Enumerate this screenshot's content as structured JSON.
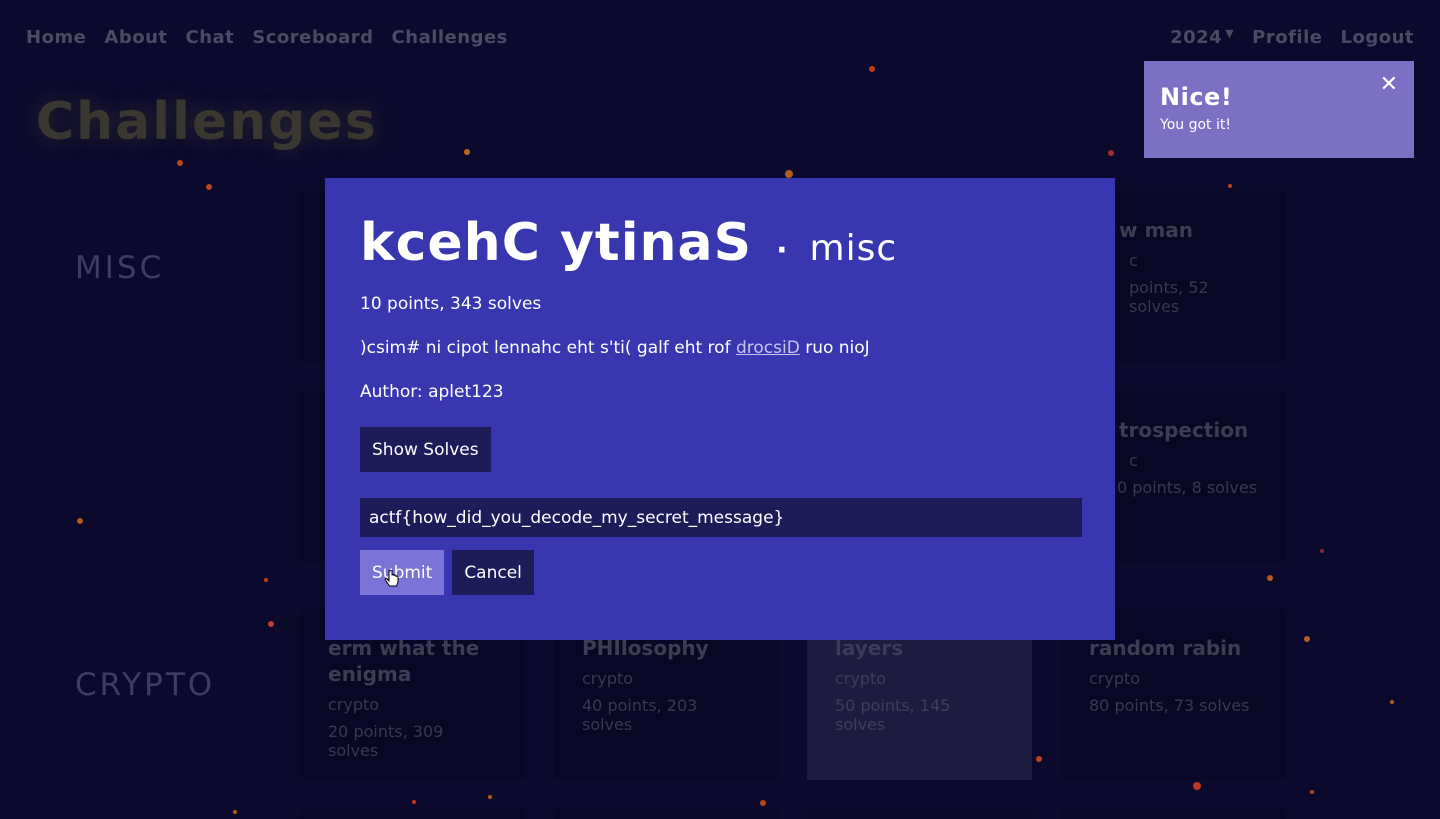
{
  "nav": {
    "left": [
      "Home",
      "About",
      "Chat",
      "Scoreboard",
      "Challenges"
    ],
    "year": "2024",
    "right": [
      "Profile",
      "Logout"
    ]
  },
  "page_title": "Challenges",
  "sections": {
    "misc": "MISC",
    "crypto": "CRYPTO"
  },
  "misc_cards": [
    {
      "title": "w man",
      "category": "c",
      "stats": "points, 52 solves"
    },
    {
      "title": "trospection",
      "category": "c",
      "stats": "0 points, 8 solves"
    }
  ],
  "crypto_cards": [
    {
      "title": "erm what the enigma",
      "category": "crypto",
      "stats": "20 points, 309 solves",
      "solved": false
    },
    {
      "title": "PHIlosophy",
      "category": "crypto",
      "stats": "40 points, 203 solves",
      "solved": false
    },
    {
      "title": "layers",
      "category": "crypto",
      "stats": "50 points, 145 solves",
      "solved": true
    },
    {
      "title": "random rabin",
      "category": "crypto",
      "stats": "80 points, 73 solves",
      "solved": false
    }
  ],
  "modal": {
    "title": "kcehC ytinaS",
    "separator": "·",
    "category": "misc",
    "stats": "10 points, 343 solves",
    "desc_before": ")csim# ni cipot lennahc eht s'ti( galf eht rof ",
    "desc_link": "drocsiD",
    "desc_after": " ruo nioJ",
    "author": "Author: aplet123",
    "show_solves": "Show Solves",
    "flag_value": "actf{how_did_you_decode_my_secret_message}",
    "submit": "Submit",
    "cancel": "Cancel"
  },
  "toast": {
    "title": "Nice!",
    "message": "You got it!",
    "close": "✕"
  },
  "colors": {
    "background": "#0b0a2c",
    "modal": "#3837b0",
    "button_dark": "#1e1b59",
    "button_light": "#7b73d5",
    "toast": "#7c70c5"
  },
  "icons": [
    "caret-down-icon",
    "close-icon",
    "hand-pointer-cursor-icon"
  ]
}
